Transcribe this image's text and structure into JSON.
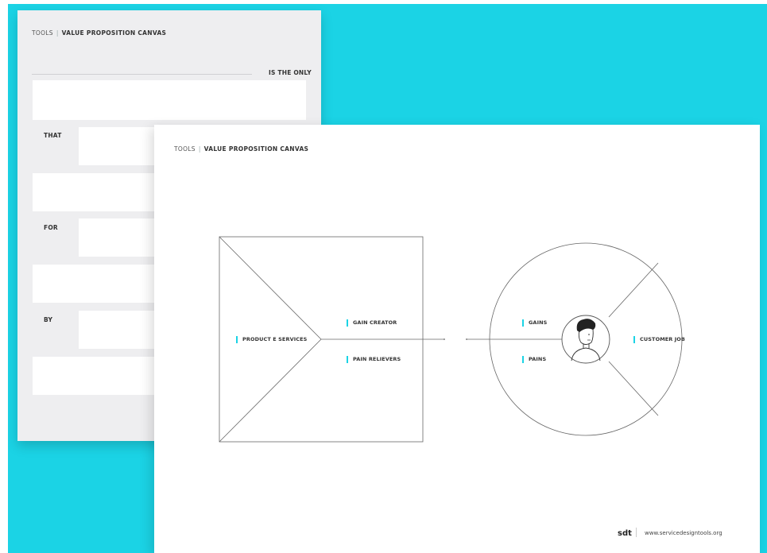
{
  "back_card": {
    "header_tools": "TOOLS",
    "header_sep": "|",
    "header_title": "VALUE PROPOSITION CANVAS",
    "is_the_only": "IS THE ONLY",
    "labels": {
      "that": "THAT",
      "for": "FOR",
      "by": "BY"
    }
  },
  "front_card": {
    "header_tools": "TOOLS",
    "header_sep": "|",
    "header_title": "VALUE PROPOSITION CANVAS",
    "value_map": {
      "product_services": "PRODUCT E SERVICES",
      "gain_creator": "GAIN CREATOR",
      "pain_relievers": "PAIN RELIEVERS"
    },
    "customer_profile": {
      "gains": "GAINS",
      "pains": "PAINS",
      "customer_job": "CUSTOMER JOB",
      "avatar_icon": "person-avatar-icon"
    },
    "footer": {
      "logo": "sdt",
      "sep": "|",
      "url": "www.servicedesigntools.org"
    }
  },
  "colors": {
    "background": "#1bd3e5",
    "accent": "#1bd3e5",
    "back_card": "#eeeef0",
    "front_card": "#ffffff"
  }
}
